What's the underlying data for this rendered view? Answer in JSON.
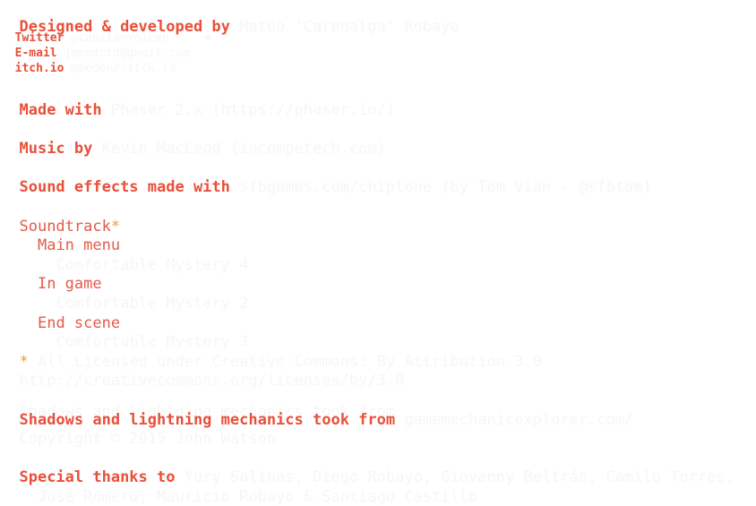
{
  "credits": {
    "designed": {
      "label": "Designed & developed by",
      "value": " Mateo 'Carenalga' Robayo"
    },
    "twitter": {
      "label": "Twitter",
      "value": " @capitanvolcan     ❤"
    },
    "email": {
      "label": "E-mail",
      "value": " jmpedcrd@gmail.com"
    },
    "itch": {
      "label": "itch.io",
      "value": " mpedoor.itch.io"
    },
    "made_with": {
      "label": "Made with",
      "value": " Phaser 2.x (https://phaser.io/)"
    },
    "music_by": {
      "label": "Music by",
      "value": " Kevin MacLeod (incompetech.com)"
    },
    "sound_effects": {
      "label": "Sound effects made with",
      "value": " sfbgames.com/chiptone (by Tom Vian - @sfbtom)"
    },
    "soundtrack": {
      "label": "Soundtrack",
      "star": "*",
      "items": [
        {
          "scene": "Main menu",
          "track": "Comfortable Mystery 4"
        },
        {
          "scene": "In game",
          "track": "Comfortable Mystery 2"
        },
        {
          "scene": "End scene",
          "track": "Comfortable Mystery 3"
        }
      ],
      "license_star": "*",
      "license": " All Licensed under Creative Commons: By Attribution 3.0",
      "license_url": "http://creativecommons.org/licenses/by/3.0"
    },
    "shadows": {
      "behind": "Shadows and lightning mechanics took from",
      "label": "Shadows and lightning mechanics took from",
      "value": " gamemechanicexplorer.com/",
      "copyright": "Copyright © 2015 John Watson"
    },
    "special_thanks": {
      "label": "Special thanks to",
      "value": " Yury Salinas, Diego Robayo, Giovanny Beltrán, Camilo Torres,",
      "value2": "  José Romero, Mauricio Robayo & Santiago Castillo"
    }
  },
  "colors": {
    "heading": "#e8503a",
    "subheading": "#e25b4a",
    "faint_text": "#f6f6f6",
    "star": "#f09a2c",
    "background": "#ffffff"
  }
}
